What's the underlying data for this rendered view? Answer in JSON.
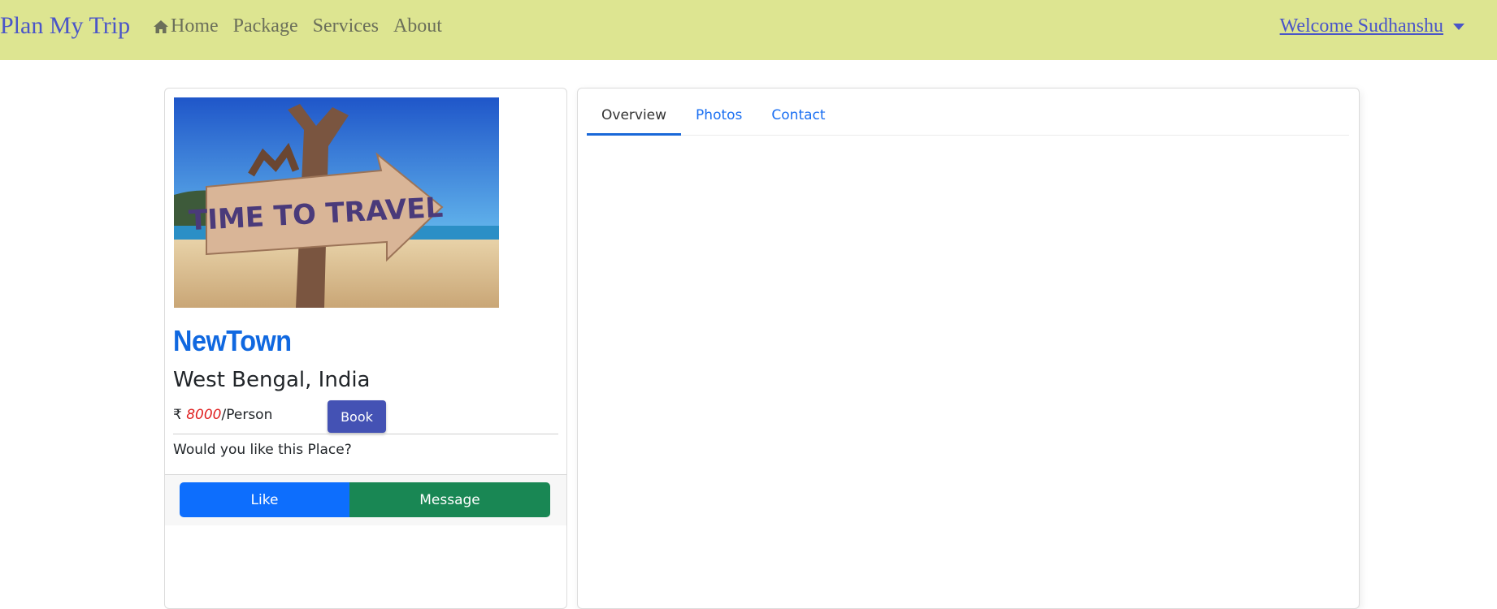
{
  "nav": {
    "brand": "Plan My Trip",
    "links": [
      "Home",
      "Package",
      "Services",
      "About"
    ],
    "welcome": "Welcome Sudhanshu "
  },
  "place": {
    "image_text": "TIME TO TRAVEL",
    "name": "NewTown",
    "location": "West Bengal, India",
    "currency": "₹",
    "price": "8000",
    "price_unit": "/Person",
    "book_label": "Book",
    "question": "Would you like this Place?",
    "like_label": "Like",
    "message_label": "Message"
  },
  "tabs": [
    "Overview",
    "Photos",
    "Contact"
  ],
  "colors": {
    "navbar_bg": "#dde591",
    "brand": "#4a55c8",
    "place_name": "#1068e0",
    "price": "#e02020",
    "book": "#4452b4",
    "like": "#0d6efd",
    "message": "#198754"
  },
  "icons": {
    "home": "home-icon",
    "dropdown": "caret-down-icon"
  }
}
